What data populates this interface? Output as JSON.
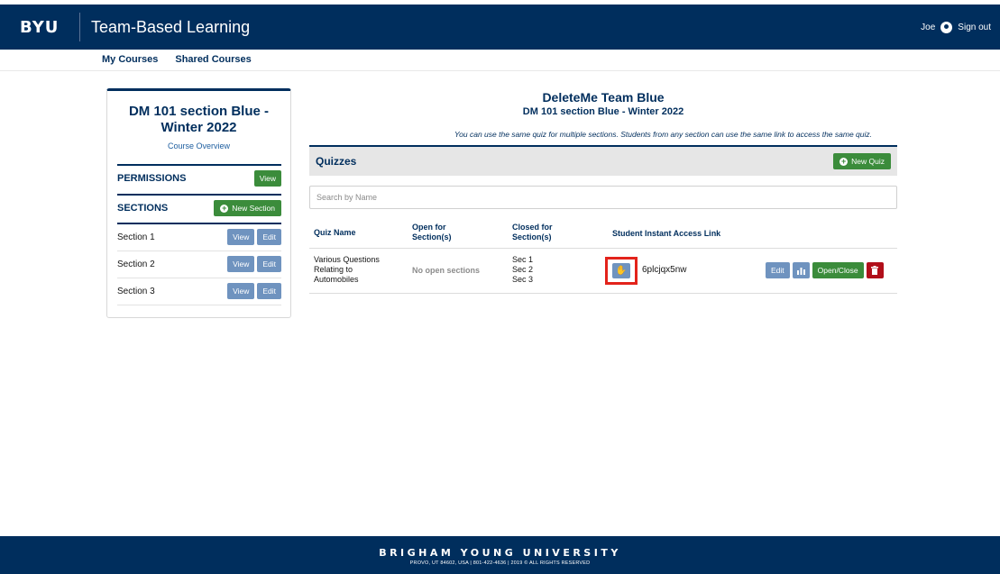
{
  "header": {
    "logo": "BYU",
    "app_title": "Team-Based Learning",
    "user_name": "Joe",
    "user_icon": "user-circle-icon",
    "sign_out": "Sign out"
  },
  "nav": {
    "items": [
      {
        "label": "My Courses"
      },
      {
        "label": "Shared Courses"
      }
    ]
  },
  "sidebar": {
    "course_title_line1": "DM 101 section Blue -",
    "course_title_line2": "Winter 2022",
    "course_overview": "Course Overview",
    "permissions": {
      "label": "PERMISSIONS",
      "button": "View"
    },
    "sections": {
      "label": "SECTIONS",
      "new_button": "New Section",
      "items": [
        {
          "name": "Section 1",
          "view": "View",
          "edit": "Edit"
        },
        {
          "name": "Section 2",
          "view": "View",
          "edit": "Edit"
        },
        {
          "name": "Section 3",
          "view": "View",
          "edit": "Edit"
        }
      ]
    }
  },
  "main": {
    "title": "DeleteMe Team Blue",
    "subtitle": "DM 101 section Blue - Winter 2022",
    "note": "You can use the same quiz for multiple sections. Students from any section can use the same link to access the same quiz.",
    "quizzes_title": "Quizzes",
    "new_quiz_button": "New Quiz",
    "search_placeholder": "Search by Name",
    "columns": {
      "quiz_name": "Quiz Name",
      "open_for_1": "Open for",
      "open_for_2": "Section(s)",
      "closed_for_1": "Closed for",
      "closed_for_2": "Section(s)",
      "access_link": "Student Instant Access Link"
    },
    "rows": [
      {
        "name_1": "Various Questions",
        "name_2": "Relating to",
        "name_3": "Automobiles",
        "open": "No open sections",
        "closed_1": "Sec 1",
        "closed_2": "Sec 2",
        "closed_3": "Sec 3",
        "access_icon": "pointer-hand-icon",
        "access_code": "6plcjqx5nw",
        "edit": "Edit",
        "chart_icon": "bar-chart-icon",
        "open_close": "Open/Close",
        "delete_icon": "trash-icon"
      }
    ]
  },
  "footer": {
    "university": "BRIGHAM YOUNG UNIVERSITY",
    "address": "PROVO, UT 84602, USA | 801-422-4636 | 2019 © ALL RIGHTS RESERVED"
  },
  "colors": {
    "navy": "#002e5d",
    "green": "#3b8c3b",
    "blue_button": "#6f93bf",
    "red": "#b10f1a",
    "highlight": "#e3231b"
  }
}
